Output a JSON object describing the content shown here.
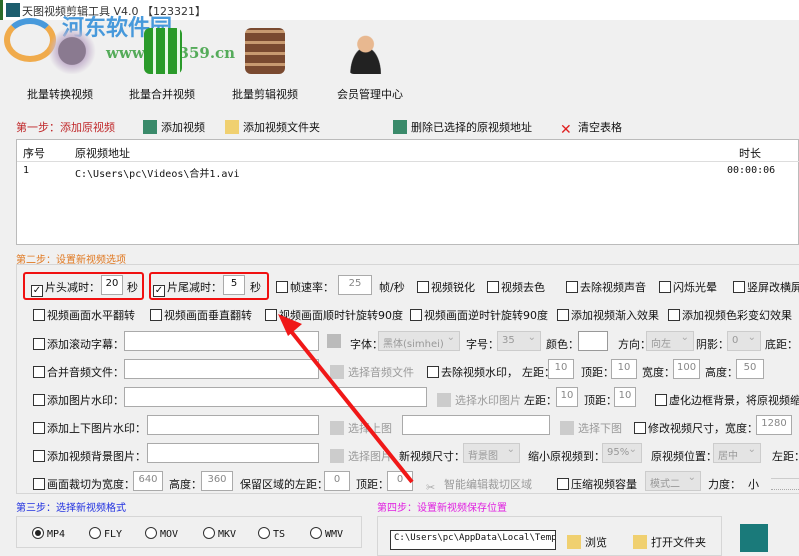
{
  "window": {
    "title": "天图视频剪辑工具 V4.0 【123321】"
  },
  "watermark": {
    "name": "河东软件园",
    "url": "www.pc0359.cn"
  },
  "toolbar": [
    {
      "label": "批量转换视频",
      "icon": "film-reel-icon"
    },
    {
      "label": "批量合并视频",
      "icon": "merge-grid-icon"
    },
    {
      "label": "批量剪辑视频",
      "icon": "film-scissors-icon"
    },
    {
      "label": "会员管理中心",
      "icon": "users-icon"
    }
  ],
  "step1": {
    "label": "第一步：添加原视频",
    "add_video": "添加视频",
    "add_folder": "添加视频文件夹",
    "delete_selected": "删除已选择的原视频地址",
    "clear_table": "清空表格"
  },
  "table": {
    "headers": [
      "序号",
      "原视频地址",
      "时长"
    ],
    "rows": [
      [
        "1",
        "C:\\Users\\pc\\Videos\\合并1.avi",
        "00:00:06"
      ]
    ]
  },
  "step2": {
    "label": "第二步：设置新视频选项",
    "head_trim": {
      "label": "片头减时：",
      "value": "20",
      "unit": "秒"
    },
    "tail_trim": {
      "label": "片尾减时：",
      "value": "5",
      "unit": "秒"
    },
    "frame_rate": {
      "label": "帧速率：",
      "value": "25",
      "unit": "帧/秒"
    },
    "row1": [
      "视频锐化",
      "视频去色",
      "去除视频声音",
      "闪烁光晕",
      "竖屏改横屏"
    ],
    "row2": [
      "视频画面水平翻转",
      "视频画面垂直翻转",
      "视频画面顺时针旋转90度",
      "视频画面逆时针旋转90度",
      "添加视频渐入效果",
      "添加视频色彩变幻效果"
    ],
    "subtitle": {
      "label": "添加滚动字幕：",
      "font_label": "字体：",
      "font": "黑体(simhei)",
      "size_label": "字号：",
      "size": "35",
      "color_label": "颜色：",
      "dir_label": "方向：",
      "dir": "向左",
      "shadow_label": "阴影：",
      "shadow": "0",
      "bottom_label": "底距："
    },
    "audio": {
      "label": "合并音频文件：",
      "choose": "选择音频文件",
      "remove_wm": "去除视频水印，",
      "left_label": "左距：",
      "left": "10",
      "top_label": "顶距：",
      "top": "10",
      "width_label": "宽度：",
      "width": "100",
      "height_label": "高度：",
      "height": "50"
    },
    "image_wm": {
      "label": "添加图片水印：",
      "choose": "选择水印图片",
      "left_label": "左距：",
      "left": "10",
      "top_label": "顶距：",
      "top": "10",
      "blur": "虚化边框背景，将原视频缩"
    },
    "updown_wm": {
      "label": "添加上下图片水印：",
      "choose_top": "选择上图",
      "choose_bottom": "选择下图",
      "resize": "修改视频尺寸，宽度：",
      "resize_width": "1280"
    },
    "bg_image": {
      "label": "添加视频背景图片：",
      "choose": "选择图片",
      "new_size_label": "新视频尺寸：",
      "new_size": "背景图",
      "shrink_label": "缩小原视频到：",
      "shrink": "95%",
      "pos_label": "原视频位置：",
      "pos": "居中",
      "left_label": "左距："
    },
    "crop": {
      "label": "画面裁切为宽度：",
      "width": "640",
      "height_label": "高度：",
      "height": "360",
      "left_label": "保留区域的左距：",
      "left": "0",
      "top_label": "顶距：",
      "top": "0",
      "smart": "智能编辑裁切区域",
      "compress": "压缩视频容量",
      "mode": "模式二",
      "strength_label": "力度：",
      "strength": "小"
    }
  },
  "step3": {
    "label": "第三步：选择新视频格式",
    "formats": [
      "MP4",
      "FLY",
      "MOV",
      "MKV",
      "TS",
      "WMV"
    ],
    "selected": "MP4"
  },
  "step4": {
    "label": "第四步：设置新视频保存位置",
    "path": "C:\\Users\\pc\\AppData\\Local\\Temp",
    "browse": "浏览",
    "open_folder": "打开文件夹"
  }
}
